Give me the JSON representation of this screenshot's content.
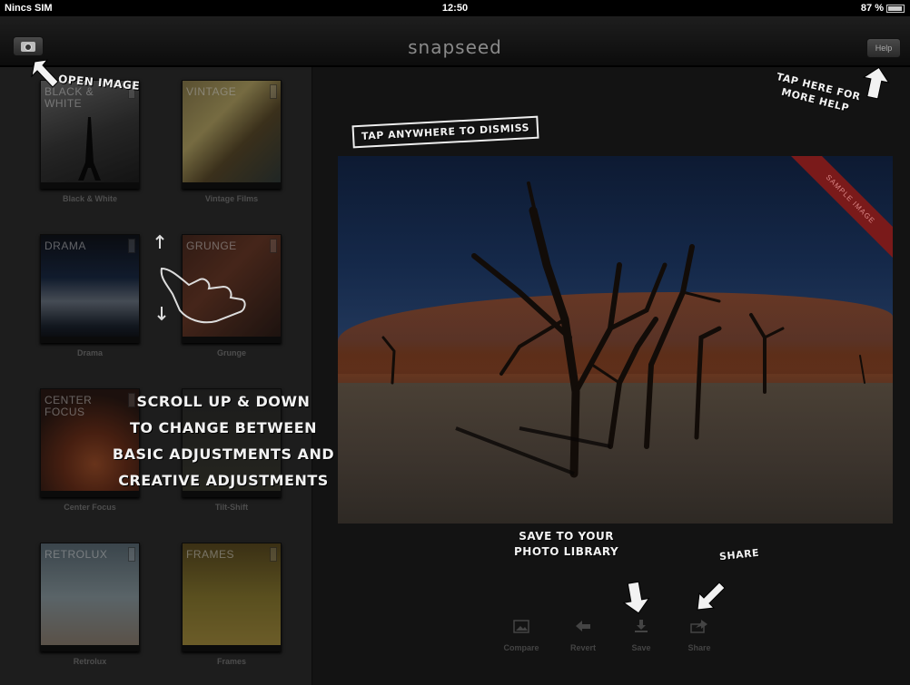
{
  "status_bar": {
    "carrier": "Nincs SIM",
    "time": "12:50",
    "battery": "87 %"
  },
  "nav": {
    "title": "snapseed",
    "help_label": "Help"
  },
  "filters": [
    {
      "name": "BLACK &\nWHITE",
      "caption": "Black & White"
    },
    {
      "name": "VINTAGE",
      "caption": "Vintage Films"
    },
    {
      "name": "DRAMA",
      "caption": "Drama"
    },
    {
      "name": "GRUNGE",
      "caption": "Grunge"
    },
    {
      "name": "CENTER\nFOCUS",
      "caption": "Center Focus"
    },
    {
      "name": "",
      "caption": "Tilt-Shift"
    },
    {
      "name": "RETROLUX",
      "caption": "Retrolux"
    },
    {
      "name": "FRAMES",
      "caption": "Frames"
    }
  ],
  "photo": {
    "ribbon": "SAMPLE IMAGE"
  },
  "toolbar": {
    "compare": "Compare",
    "revert": "Revert",
    "save": "Save",
    "share": "Share"
  },
  "annotations": {
    "open_image": "OPEN IMAGE",
    "dismiss": "TAP ANYWHERE TO DISMISS",
    "help": "TAP HERE FOR\nMORE HELP",
    "scroll": "SCROLL UP & DOWN\nTO CHANGE BETWEEN\nBASIC ADJUSTMENTS AND\nCREATIVE ADJUSTMENTS",
    "save": "SAVE TO YOUR\nPHOTO LIBRARY",
    "share": "SHARE"
  }
}
